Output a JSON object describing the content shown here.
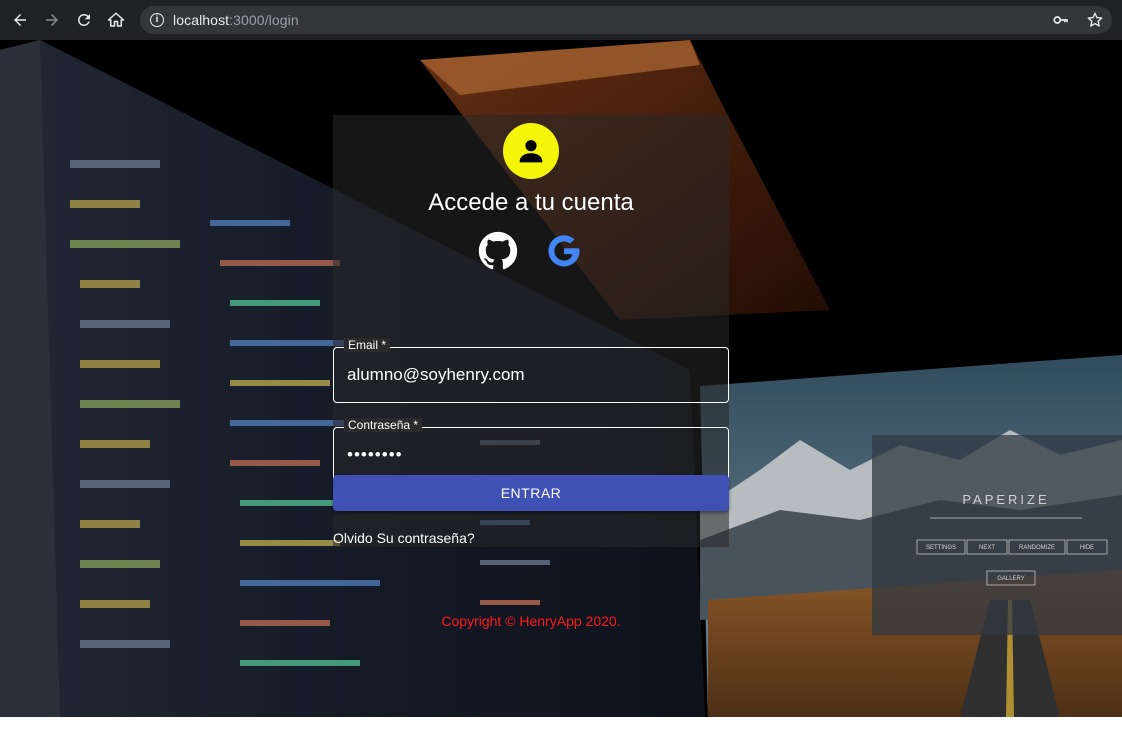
{
  "browser": {
    "url_host": "localhost",
    "url_path": ":3000/login"
  },
  "login": {
    "title": "Accede a tu cuenta",
    "email_label": "Email *",
    "email_value": "alumno@soyhenry.com",
    "password_label": "Contraseña *",
    "password_value": "••••••••",
    "submit_label": "ENTRAR",
    "forgot_link": "Olvido Su contraseña?"
  },
  "footer": {
    "copyright": "Copyright © HenryApp 2020."
  },
  "wallpaper_app": {
    "title": "PAPERIZE",
    "buttons": [
      "SETTINGS",
      "NEXT",
      "RANDOMIZE",
      "HIDE"
    ],
    "gallery": "GALLERY"
  },
  "colors": {
    "accent": "#3f51b5",
    "avatar": "#f5f50a",
    "copyright": "#ff1a1a"
  }
}
